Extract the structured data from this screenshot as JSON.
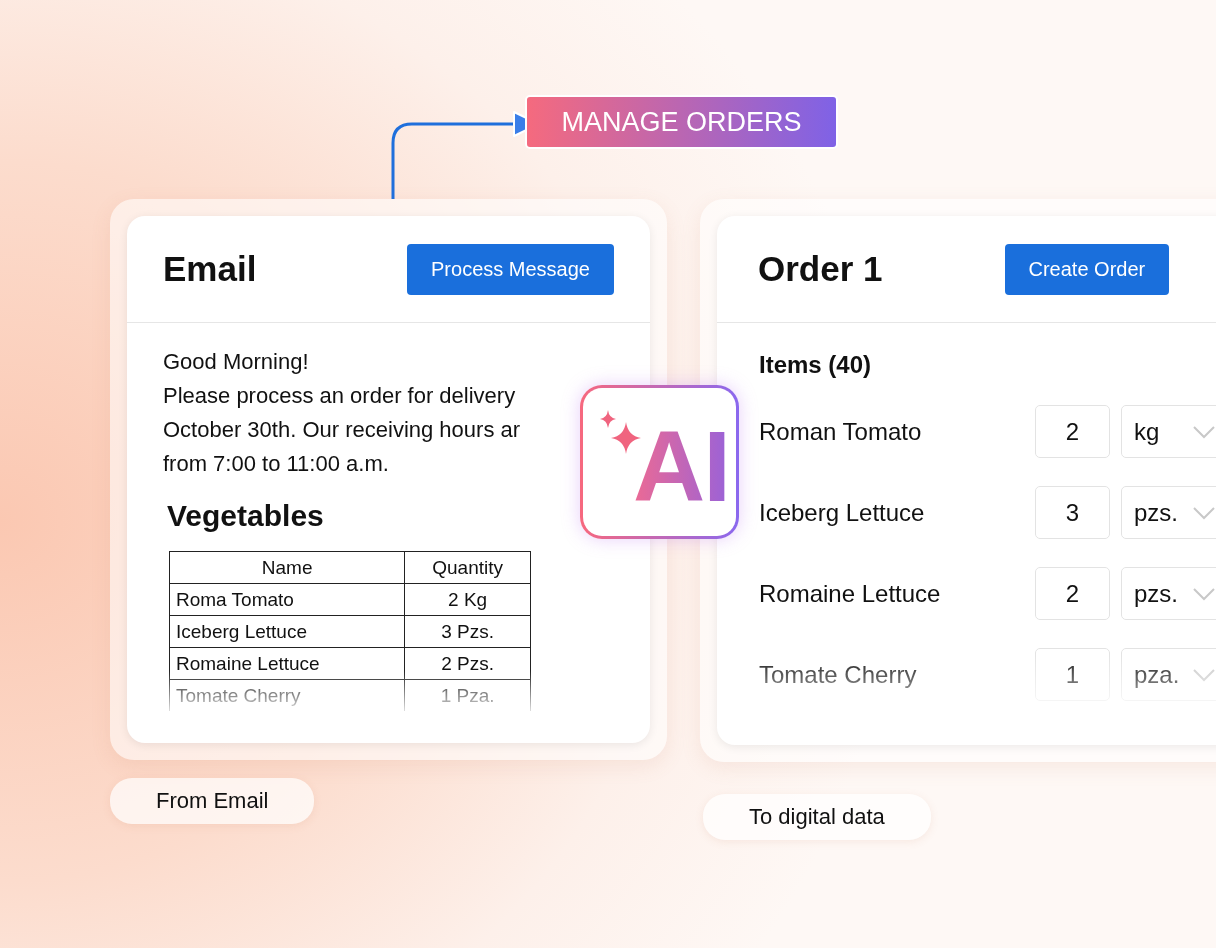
{
  "flow_label": "MANAGE ORDERS",
  "email": {
    "title": "Email",
    "button": "Process Message",
    "body_lines": [
      "Good Morning!",
      "Please process an order for delivery",
      "October 30th. Our receiving hours ar",
      "from 7:00 to 11:00 a.m."
    ],
    "section": "Vegetables",
    "table": {
      "columns": [
        "Name",
        "Quantity"
      ],
      "rows": [
        [
          "Roma Tomato",
          "2 Kg"
        ],
        [
          "Iceberg Lettuce",
          "3 Pzs."
        ],
        [
          "Romaine Lettuce",
          "2 Pzs."
        ],
        [
          "Tomate Cherry",
          "1 Pza."
        ]
      ]
    },
    "caption": "From Email"
  },
  "ai_badge": "AI",
  "order": {
    "title": "Order 1",
    "button": "Create Order",
    "items_heading": "Items (40)",
    "items": [
      {
        "name": "Roman Tomato",
        "quantity": "2",
        "unit": "kg"
      },
      {
        "name": "Iceberg Lettuce",
        "quantity": "3",
        "unit": "pzs."
      },
      {
        "name": "Romaine Lettuce",
        "quantity": "2",
        "unit": "pzs."
      },
      {
        "name": "Tomate Cherry",
        "quantity": "1",
        "unit": "pza."
      }
    ],
    "caption": "To digital data"
  }
}
